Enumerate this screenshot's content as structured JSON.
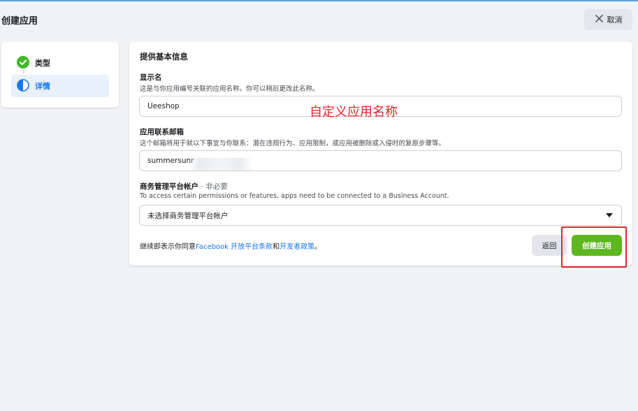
{
  "header": {
    "title": "创建应用",
    "cancel_label": "取消"
  },
  "steps": {
    "items": [
      {
        "label": "类型",
        "state": "done"
      },
      {
        "label": "详情",
        "state": "active"
      }
    ]
  },
  "form": {
    "section_title": "提供基本信息",
    "display_name": {
      "label": "显示名",
      "description": "这是与你应用编号关联的应用名称。你可以稍后更改此名称。",
      "value": "Ueeshop"
    },
    "email": {
      "label": "应用联系邮箱",
      "description": "这个邮箱将用于就以下事宜与你联系：潜在违规行为、应用限制，或应用被删除或入侵时的复原步骤等。",
      "value": "summersunr"
    },
    "business": {
      "label": "商务管理平台帐户",
      "optional": "· 非必要",
      "description": "To access certain permissions or features, apps need to be connected to a Business Account.",
      "selected": "未选择商务管理平台帐户"
    },
    "terms": {
      "prefix": "继续即表示你同意",
      "link1": "Facebook 开放平台条款",
      "middle": "和",
      "link2": "开发者政策",
      "suffix": "。"
    },
    "back_label": "返回",
    "create_label": "创建应用"
  },
  "annotation": {
    "text": "自定义应用名称",
    "color": "#e8262a"
  },
  "colors": {
    "accent": "#1877f2",
    "success": "#42b72a",
    "primary_button": "#5eb71e",
    "highlight": "#e8262a"
  },
  "icons": {
    "cancel": "close-icon",
    "step_done": "check-circle-icon",
    "step_active": "half-circle-icon",
    "dropdown": "caret-down-icon"
  }
}
